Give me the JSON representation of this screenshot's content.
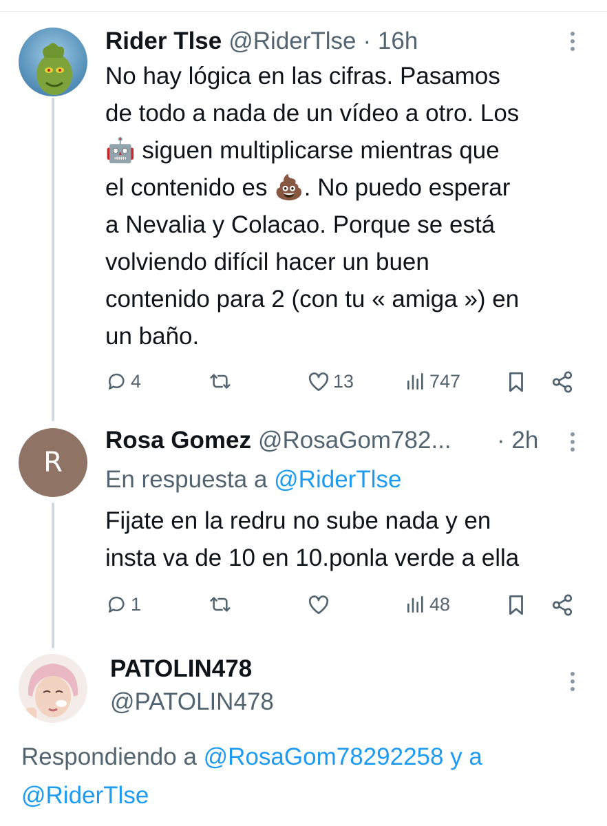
{
  "tweet1": {
    "name": "Rider Tlse",
    "handle": "@RiderTlse",
    "time": "· 16h",
    "line1": "No hay lógica en las cifras. Pasamos",
    "line2": "de todo a nada de un vídeo a otro. Los",
    "line3_emoji": "🤖",
    "line3": " siguen multiplicarse mientras que",
    "line4a": "el contenido es ",
    "line4_emoji": "💩",
    "line4b": ". No puedo esperar",
    "line5": "a Nevalia y Colacao. Porque se está",
    "line6": "volviendo difícil hacer un buen",
    "line7": "contenido para 2 (con tu « amiga ») en",
    "line8": "un baño.",
    "replies": "4",
    "likes": "13",
    "views": "747",
    "avatar_icon": "grinch-avatar"
  },
  "tweet2": {
    "name": "Rosa Gomez",
    "handle": "@RosaGom782...",
    "time": "· 2h",
    "avatar_letter": "R",
    "avatar_color": "#8f7365",
    "reply_prefix": "En respuesta a ",
    "reply_to": "@RiderTlse",
    "line1": "Fijate en la redru no sube nada y en",
    "line2": "insta va de 10 en 10.ponla verde a ella",
    "replies": "1",
    "views": "48"
  },
  "tweet3": {
    "name": "PATOLIN478",
    "handle": "@PATOLIN478",
    "avatar_icon": "woman-pink-hat-avatar",
    "reply_prefix": "Respondiendo a ",
    "reply_to1": "@RosaGom78292258",
    "reply_joiner": " y a",
    "reply_to2": "@RiderTlse"
  },
  "colors": {
    "accent": "#1d9bf0",
    "text": "#0f1419",
    "muted": "#536471",
    "thread": "#cfd9de"
  }
}
